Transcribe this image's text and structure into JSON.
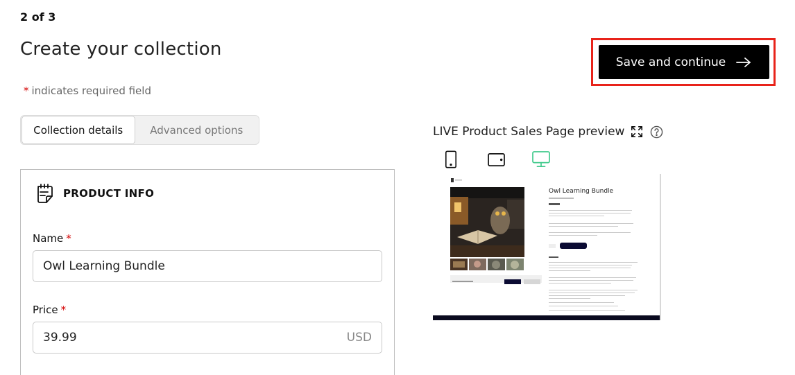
{
  "step": "2 of 3",
  "page_title": "Create your collection",
  "required_note": {
    "star": "*",
    "text": "indicates required field"
  },
  "save_button": {
    "label": "Save and continue",
    "icon": "arrow-right-icon"
  },
  "tabs": [
    {
      "label": "Collection details",
      "active": true
    },
    {
      "label": "Advanced options",
      "active": false
    }
  ],
  "product_info": {
    "title": "PRODUCT INFO",
    "icon": "product-note-icon",
    "name_label": "Name",
    "name_value": "Owl Learning Bundle",
    "price_label": "Price",
    "price_value": "39.99",
    "currency": "USD",
    "required_star": "*"
  },
  "preview": {
    "title": "LIVE Product Sales Page preview",
    "icons": [
      "expand-icon",
      "help-icon"
    ],
    "devices": [
      {
        "name": "mobile-icon",
        "active": false
      },
      {
        "name": "tablet-icon",
        "active": false
      },
      {
        "name": "desktop-icon",
        "active": true
      }
    ],
    "product_title": "Owl Learning Bundle",
    "active_color": "#3ec98a"
  },
  "colors": {
    "accent": "#000000",
    "required": "#d40000",
    "highlight": "#e8231a"
  }
}
